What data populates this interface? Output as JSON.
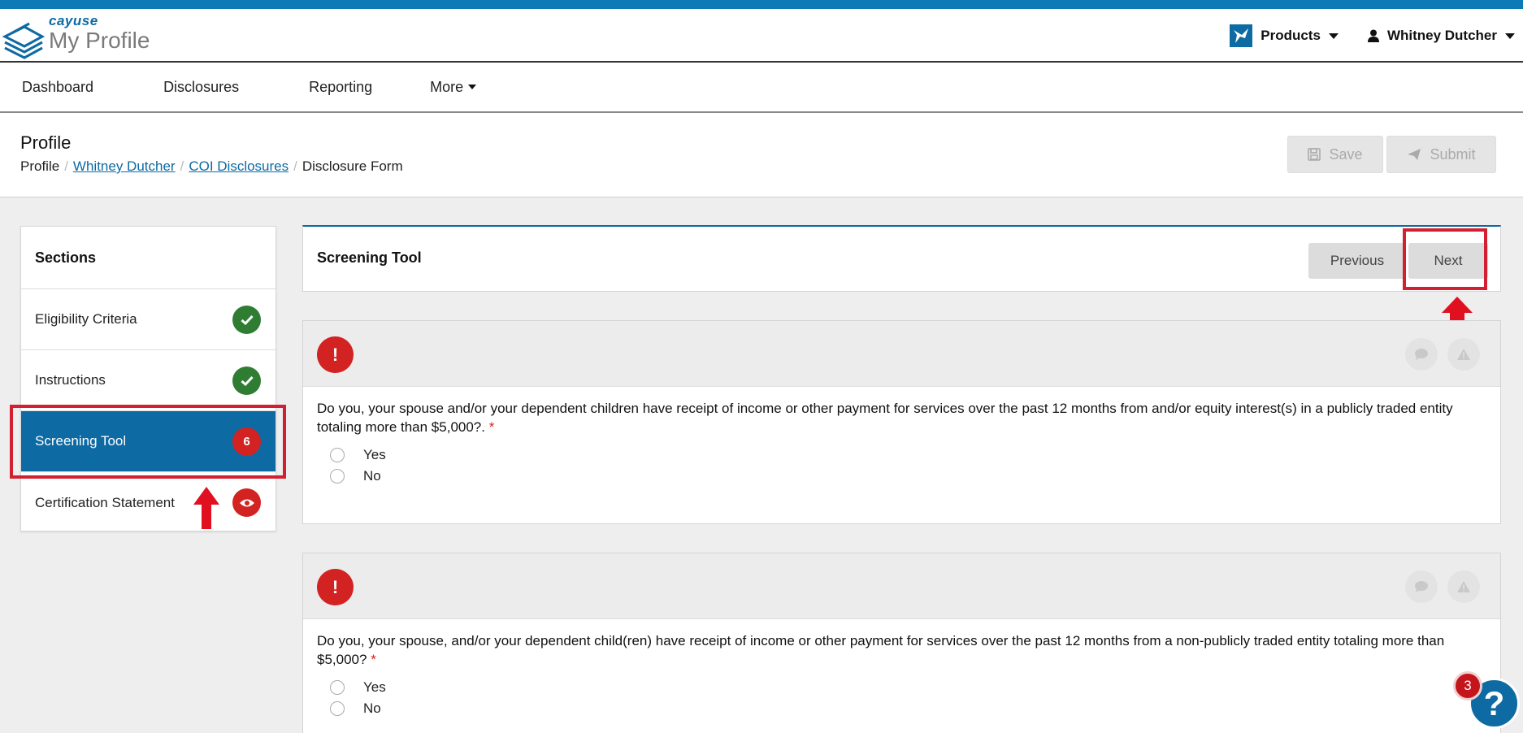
{
  "app": {
    "brand_small": "cayuse",
    "brand_big": "My Profile",
    "products_label": "Products",
    "user_name": "Whitney Dutcher"
  },
  "nav": {
    "items": [
      "Dashboard",
      "Disclosures",
      "Reporting",
      "More"
    ]
  },
  "page": {
    "title": "Profile",
    "breadcrumb": {
      "root": "Profile",
      "user": "Whitney Dutcher",
      "disclosures": "COI Disclosures",
      "current": "Disclosure Form"
    },
    "save_label": "Save",
    "submit_label": "Submit"
  },
  "sections": {
    "heading": "Sections",
    "items": [
      {
        "label": "Eligibility Criteria",
        "status": "complete"
      },
      {
        "label": "Instructions",
        "status": "complete"
      },
      {
        "label": "Screening Tool",
        "badge": "6",
        "active": true
      },
      {
        "label": "Certification Statement",
        "status": "view"
      }
    ]
  },
  "tool": {
    "title": "Screening Tool",
    "previous_label": "Previous",
    "next_label": "Next"
  },
  "questions": [
    {
      "text": "Do you, your spouse and/or your dependent children have receipt of income or other payment for services over the past 12 months from and/or equity interest(s) in a publicly traded entity totaling more than $5,000?.",
      "required_mark": "*",
      "options": [
        "Yes",
        "No"
      ]
    },
    {
      "text": "Do you, your spouse, and/or your dependent child(ren) have receipt of income or other payment for services over the past 12 months from a non-publicly traded entity totaling more than $5,000?",
      "required_mark": "*",
      "options": [
        "Yes",
        "No"
      ]
    }
  ],
  "help": {
    "count": "3",
    "symbol": "?"
  },
  "colors": {
    "primary": "#0d6aa3",
    "top_stripe": "#0d7ab8",
    "success": "#2e7d32",
    "danger": "#d32222",
    "annotation": "#d32030"
  }
}
